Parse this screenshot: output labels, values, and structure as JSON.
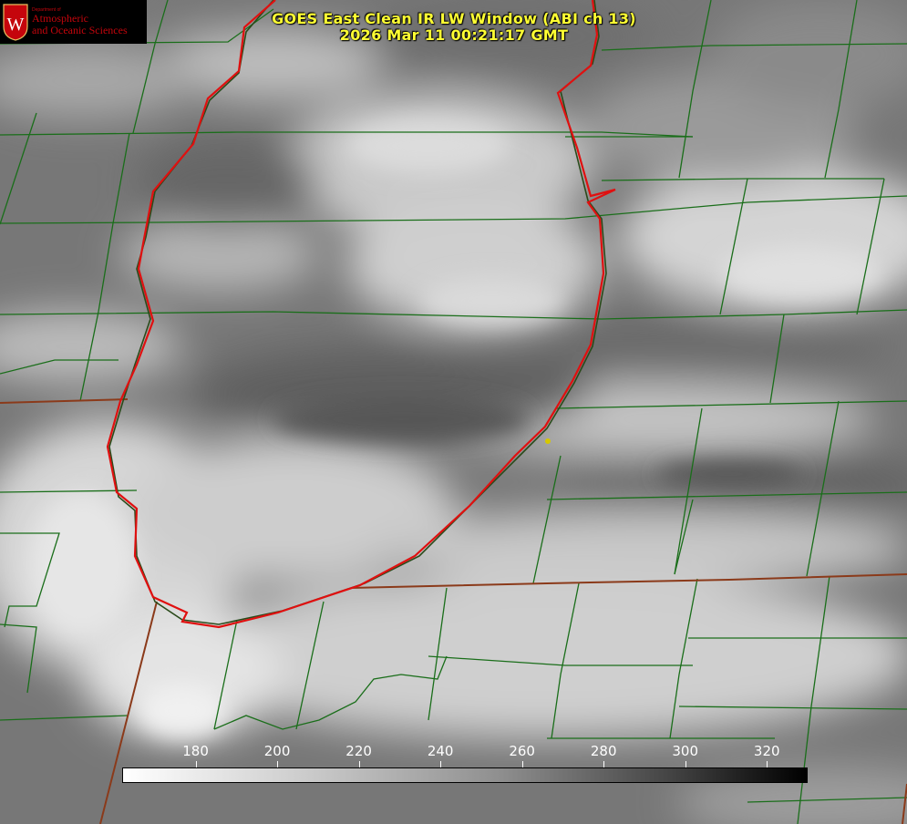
{
  "title": {
    "line1": "GOES East Clean IR LW Window (ABI ch 13)",
    "line2": "2026 Mar 11 00:21:17 GMT"
  },
  "logo": {
    "dept_label": "Department of",
    "name_line1": "Atmospheric",
    "name_line2": "and Oceanic Sciences",
    "seal_letter": "W"
  },
  "colorbar": {
    "ticks": [
      "180",
      "200",
      "220",
      "240",
      "260",
      "280",
      "300",
      "320"
    ],
    "min": 162,
    "max": 330,
    "scale": "grayscale, white = cold, black = warm"
  },
  "colors": {
    "county_lines": "#1a6e1a",
    "state_lines": "#8b3a1a",
    "lake_outline": "#e01010",
    "point_marker": "#d6c800",
    "title_text": "#ffff33"
  },
  "map_features": [
    "county-borders",
    "state-borders",
    "lake-michigan-outline",
    "city-marker"
  ]
}
